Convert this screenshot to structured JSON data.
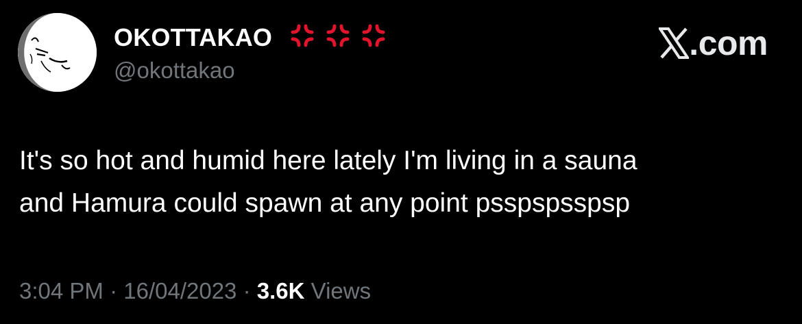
{
  "profile": {
    "display_name": "OKOTTAKAO",
    "name_emojis": [
      "anger-symbol",
      "anger-symbol",
      "anger-symbol"
    ],
    "handle": "@okottakao",
    "avatar": "moon-face-avatar"
  },
  "brand": {
    "icon": "x-logo-icon",
    "text": ".com"
  },
  "tweet": {
    "lines": [
      "It's so hot and humid here lately I'm living in a sauna",
      "and Hamura could spawn at any point psspspsspsp"
    ]
  },
  "meta": {
    "time": "3:04 PM",
    "separator": "·",
    "date": "16/04/2023",
    "views_count": "3.6K",
    "views_label": "Views"
  },
  "colors": {
    "background": "#000000",
    "primary_text": "#ffffff",
    "secondary_text": "#71767b",
    "emoji_red": "#e0142c"
  }
}
